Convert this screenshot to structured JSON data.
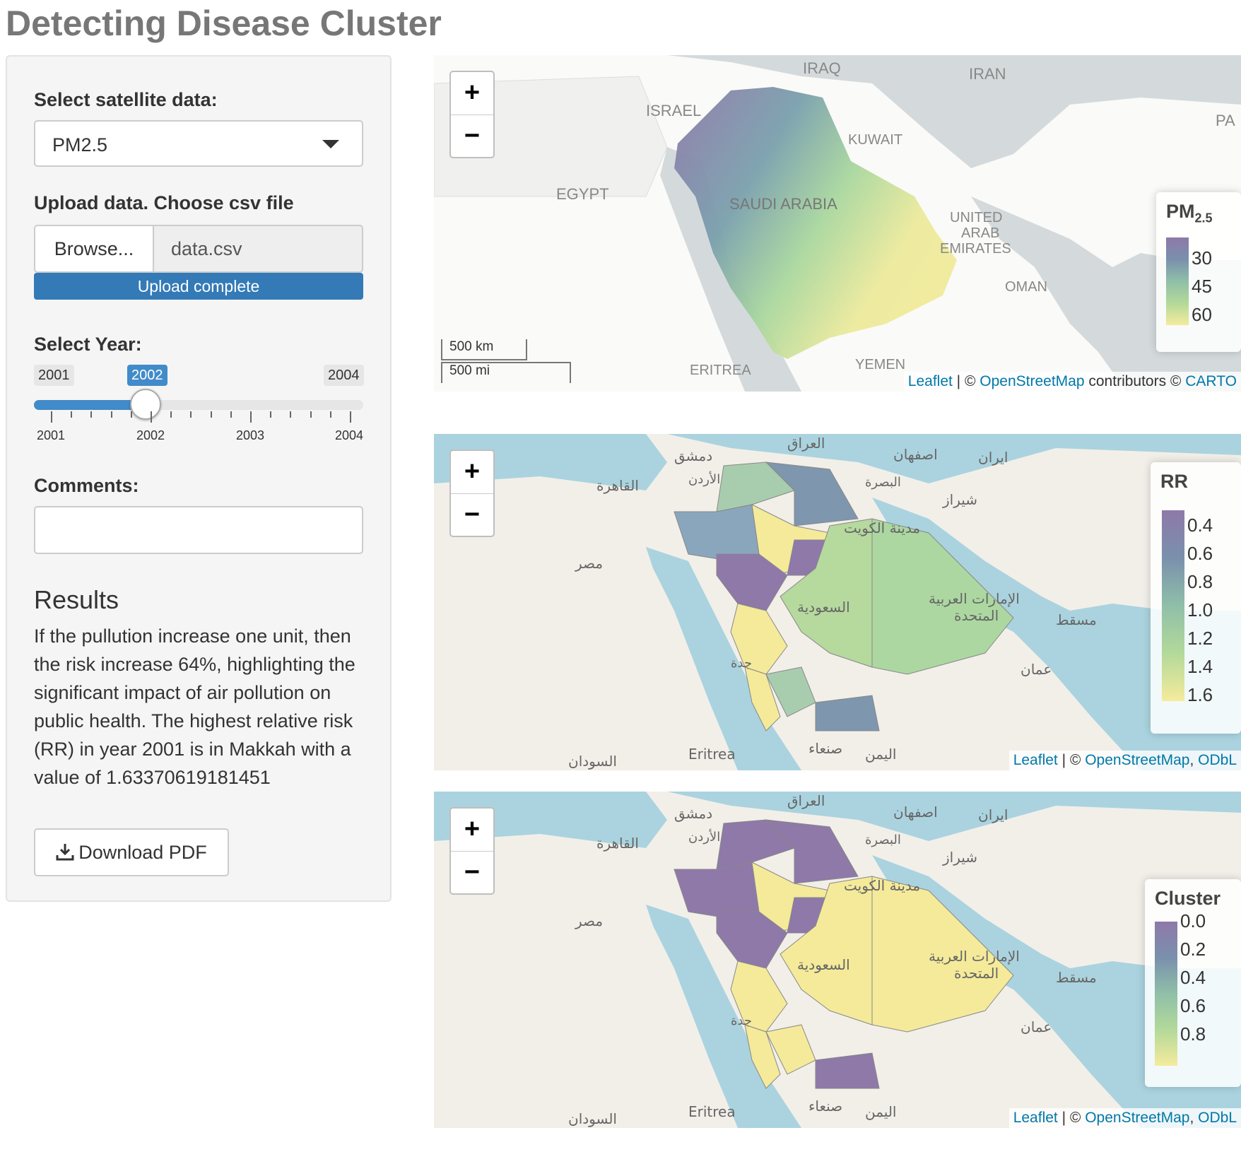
{
  "title": "Detecting Disease Cluster",
  "sidebar": {
    "satellite_label": "Select satellite data:",
    "satellite_value": "PM2.5",
    "upload_label": "Upload data. Choose csv file",
    "browse_label": "Browse...",
    "file_name": "data.csv",
    "upload_status": "Upload complete",
    "year_label": "Select Year:",
    "year_min": "2001",
    "year_selected": "2002",
    "year_max": "2004",
    "year_ticks": [
      "2001",
      "2002",
      "2003",
      "2004"
    ],
    "comments_label": "Comments:",
    "comments_value": "",
    "results_heading": "Results",
    "results_text": "If the pullution increase one unit, then the risk increase 64%, highlighting the significant impact of air pollution on public health. The highest relative risk (RR) in year 2001 is in Makkah with a value of 1.63370619181451",
    "download_label": "Download PDF"
  },
  "maps": {
    "zoom_in": "+",
    "zoom_out": "−",
    "pm25": {
      "legend_title": "PM",
      "legend_sub": "2.5",
      "legend_values": [
        "30",
        "45",
        "60"
      ],
      "scale_km": "500 km",
      "scale_mi": "500 mi",
      "attribution_link1": "Leaflet",
      "attribution_sep": " | © ",
      "attribution_link2": "OpenStreetMap",
      "attribution_mid": " contributors © ",
      "attribution_link3": "CARTO",
      "labels": [
        "IRAQ",
        "IRAN",
        "ISRAEL",
        "KUWAIT",
        "EGYPT",
        "SAUDI ARABIA",
        "UNITED",
        "ARAB",
        "EMIRATES",
        "OMAN",
        "ERITREA",
        "YEMEN",
        "PA"
      ]
    },
    "rr": {
      "legend_title": "RR",
      "legend_values": [
        "0.4",
        "0.6",
        "0.8",
        "1.0",
        "1.2",
        "1.4",
        "1.6"
      ],
      "attribution_link1": "Leaflet",
      "attribution_sep": " | © ",
      "attribution_link2": "OpenStreetMap",
      "attribution_mid": ", ",
      "attribution_link3": "ODbL",
      "labels": [
        "العراق",
        "دمشق",
        "اصفهان",
        "ايران",
        "القاهرة",
        "الأردن",
        "البصرة",
        "شيراز",
        "مدينة الكويت",
        "مصر",
        "الإمارات العربية",
        "المتحدة",
        "مسقط",
        "السعودية",
        "جدة",
        "عمان",
        "Eritrea",
        "صنعاء",
        "اليمن",
        "السودان"
      ]
    },
    "cluster": {
      "legend_title": "Cluster",
      "legend_values": [
        "0.0",
        "0.2",
        "0.4",
        "0.6",
        "0.8"
      ],
      "attribution_link1": "Leaflet",
      "attribution_sep": " | © ",
      "attribution_link2": "OpenStreetMap",
      "attribution_mid": ", ",
      "attribution_link3": "ODbL",
      "labels": [
        "العراق",
        "دمشق",
        "اصفهان",
        "ايران",
        "القاهرة",
        "الأردن",
        "البصرة",
        "شيراز",
        "مدينة الكويت",
        "مصر",
        "الإمارات العربية",
        "المتحدة",
        "مسقط",
        "السعودية",
        "جدة",
        "عمان",
        "Eritrea",
        "صنعاء",
        "اليمن",
        "السودان"
      ]
    }
  },
  "colors": {
    "accent": "#428bca",
    "progress": "#337ab7",
    "viridis_purple": "#8e79a9",
    "viridis_blue": "#7a90ad",
    "viridis_teal": "#8fbfa8",
    "viridis_green": "#b3d99a",
    "viridis_yellow": "#f5eb9c",
    "sea": "#aad3df",
    "land": "#f2efe9"
  }
}
